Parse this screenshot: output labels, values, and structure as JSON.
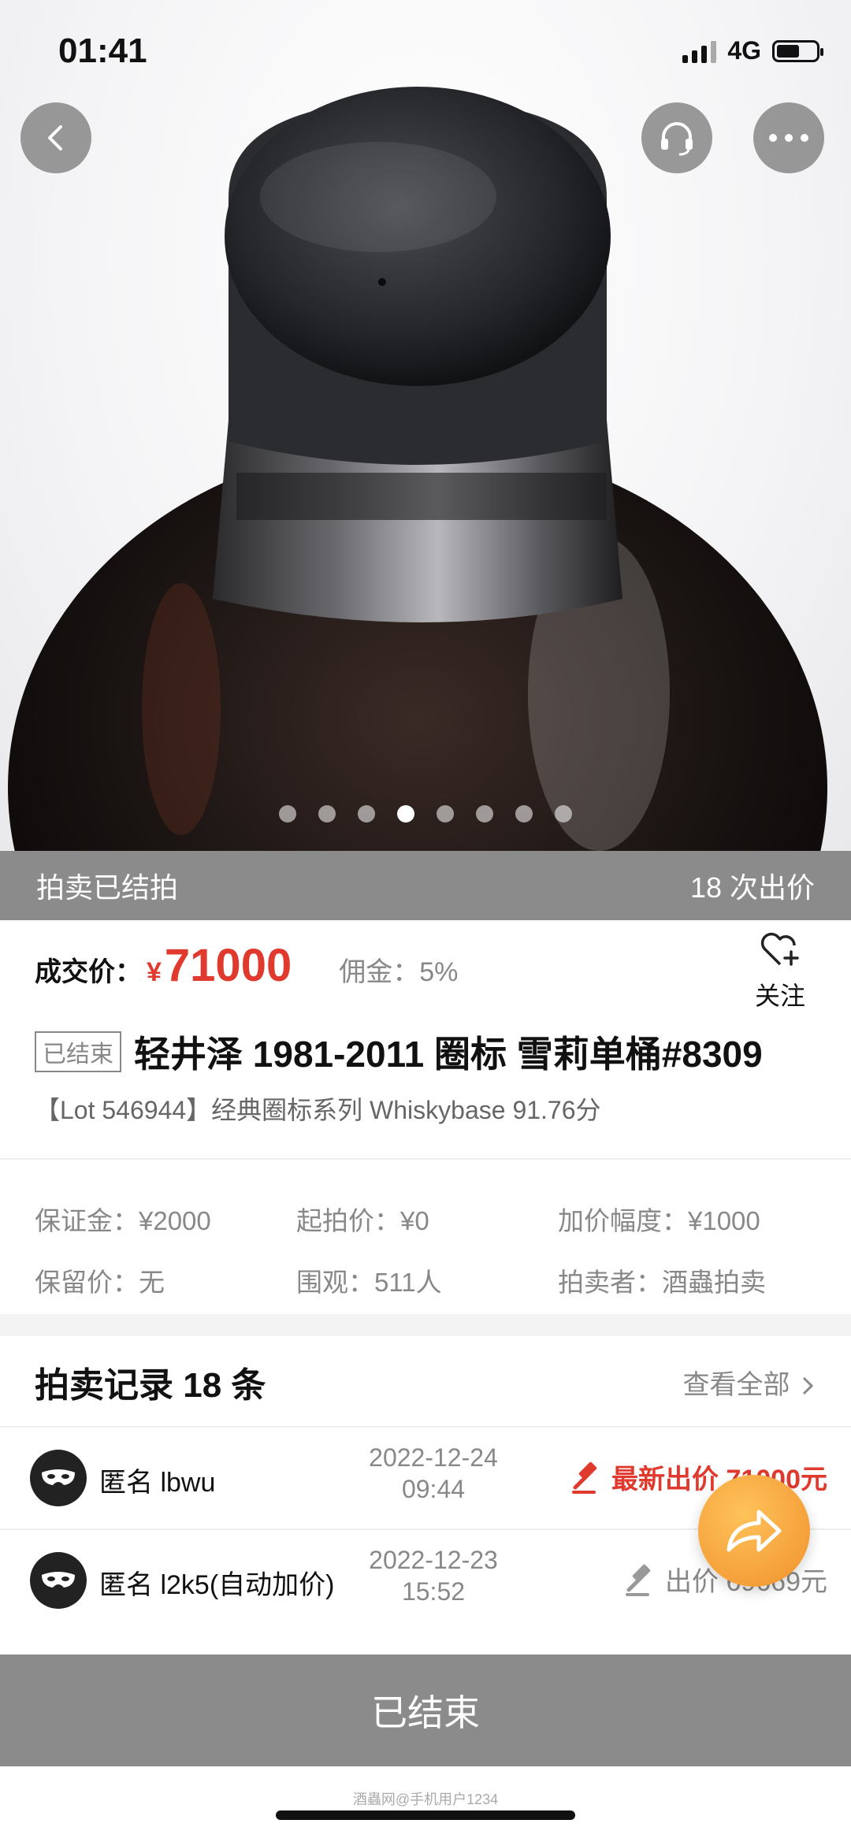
{
  "status_bar": {
    "time": "01:41",
    "network": "4G"
  },
  "gallery": {
    "dot_count": 8,
    "active_index": 3
  },
  "auction_status": {
    "state": "拍卖已结拍",
    "bid_count": "18 次出价"
  },
  "price": {
    "label": "成交价：",
    "currency": "¥",
    "value": "71000",
    "commission": "佣金：5%"
  },
  "follow": {
    "label": "关注"
  },
  "lot": {
    "tag": "已结束",
    "title": "轻井泽 1981-2011 圈标 雪莉单桶#8309",
    "subtitle": "【Lot 546944】经典圈标系列 Whiskybase 91.76分"
  },
  "info": {
    "deposit": "保证金：¥2000",
    "start_price": "起拍价：¥0",
    "increment": "加价幅度：¥1000",
    "reserve": "保留价：无",
    "watchers": "围观：511人",
    "seller": "拍卖者：酒蟲拍卖"
  },
  "records": {
    "header": "拍卖记录 18 条",
    "view_all": "查看全部",
    "items": [
      {
        "name": "匿名 lbwu",
        "date": "2022-12-24",
        "time": "09:44",
        "bid": "最新出价 71000元"
      },
      {
        "name": "匿名 l2k5(自动加价)",
        "date": "2022-12-23",
        "time": "15:52",
        "bid": "出价 69669元"
      }
    ]
  },
  "action": {
    "label": "已结束"
  },
  "watermark": "酒蟲网@手机用户1234",
  "colors": {
    "accent": "#e03a2f",
    "bar_gray": "#8b8b8b",
    "fab_orange": "#f5a03a"
  },
  "icons": [
    "back-icon",
    "customer-service-icon",
    "more-icon",
    "heart-plus-icon",
    "mask-icon",
    "gavel-icon",
    "share-icon",
    "chevron-right-icon"
  ]
}
